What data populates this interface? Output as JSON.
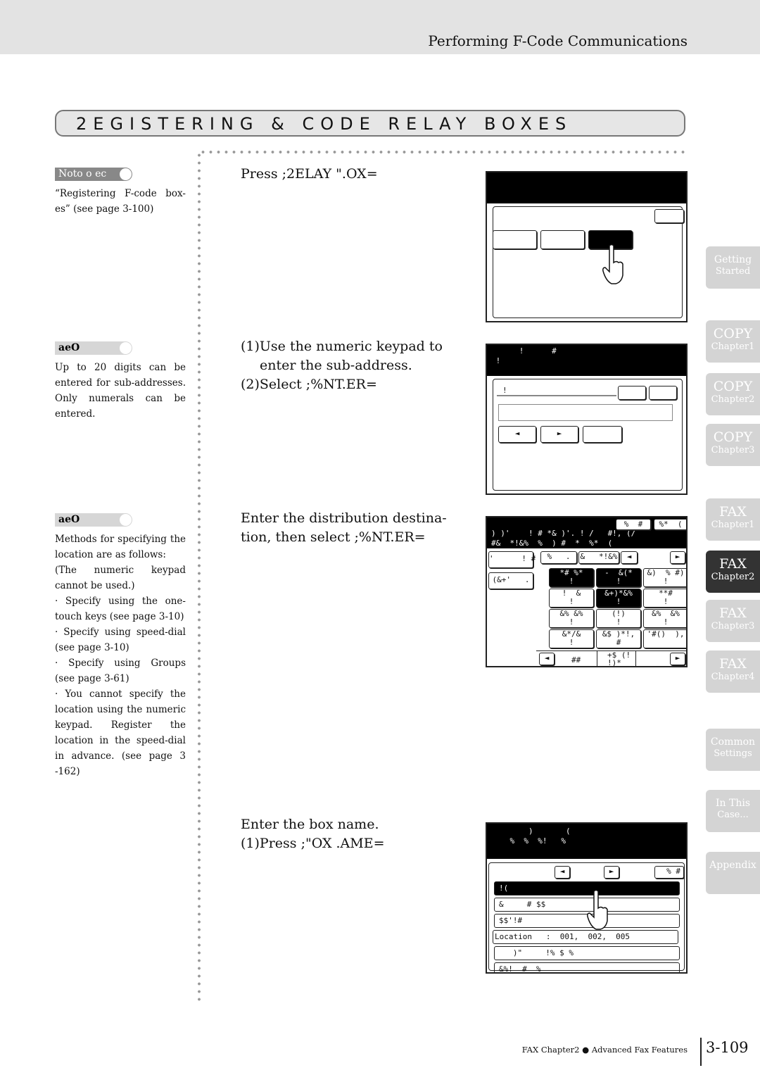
{
  "header": {
    "title": "Performing F-Code Communications"
  },
  "section_title": "2EGISTERING & CODE RELAY BOXES",
  "sidebar_notes": [
    {
      "label": "Noto o ec",
      "text": "“Registering F-code box-es” (see page 3-100)"
    },
    {
      "label": "aeO",
      "text": "Up to 20 digits can be entered for sub-addresses. Only numerals can be entered."
    },
    {
      "label": "aeO",
      "lines": [
        "Methods for specifying the location are as follows:",
        "(The numeric keypad cannot be used.)",
        "· Specify using the one-touch keys (see page 3-10)",
        "· Specify using speed-dial (see page 3-10)",
        "· Specify using Groups (see page 3-61)",
        "· You cannot specify the location using the numeric keypad. Register the location in the speed-dial in advance. (see page 3 -162)"
      ]
    }
  ],
  "steps": [
    {
      "text": "Press ;2ELAY \".OX="
    },
    {
      "lines": [
        "(1)Use the numeric keypad to",
        "enter the sub-address.",
        "(2)Select ;%NT.ER="
      ]
    },
    {
      "lines": [
        "Enter the distribution destina-",
        "tion, then select ;%NT.ER="
      ]
    },
    {
      "lines": [
        "Enter the box name.",
        "(1)Press ;\"OX .AME="
      ]
    }
  ],
  "screen2": {
    "bar": "      !      #\n !",
    "field_label": "!",
    "prev": "◄",
    "next": "►"
  },
  "screen3": {
    "top_buttons": [
      "%  #",
      "%*  ("
    ],
    "bar": ") )'    ! # *& )'. ! /   #!, (/\n#&  *!&%  %  ) #  *  %*  (",
    "left_buttons": [
      "'      ! #",
      "(&+'   ."
    ],
    "tabs": [
      "%   .",
      "&   *!&%"
    ],
    "prev": "◄",
    "next": "►",
    "grid": [
      [
        "*# %*\n!",
        "-  &(*\n!",
        "&)  % #)\n!"
      ],
      [
        "!  &\n!",
        "&+)*&%\n!",
        "**#\n!"
      ],
      [
        "&% &%\n!",
        "(!)\n!",
        "&%  &%\n!"
      ],
      [
        "&*/&\n!",
        "&$ )*!,\n#",
        "'#()  ),"
      ]
    ],
    "dark_cells": [
      [
        0,
        0
      ],
      [
        0,
        1
      ],
      [
        1,
        1
      ]
    ],
    "page_label": "##",
    "page_label2": "+$ (!\n!)*"
  },
  "screen4": {
    "bar": "        )       (\n    %  %  %!   %",
    "prev": "◄",
    "next": "►",
    "corner": "% #",
    "rows": [
      "!(",
      "&     # $$",
      "$$'!#",
      "Location   :  001,  002,  005",
      "   )\"     !% $ %",
      "&%!  #  %"
    ]
  },
  "tabs": [
    {
      "t1": "Getting",
      "t2": "Started",
      "small": true
    },
    {
      "t1": "COPY",
      "t2": "Chapter1"
    },
    {
      "t1": "COPY",
      "t2": "Chapter2"
    },
    {
      "t1": "COPY",
      "t2": "Chapter3"
    },
    {
      "t1": "FAX",
      "t2": "Chapter1"
    },
    {
      "t1": "FAX",
      "t2": "Chapter2",
      "active": true
    },
    {
      "t1": "FAX",
      "t2": "Chapter3"
    },
    {
      "t1": "FAX",
      "t2": "Chapter4"
    },
    {
      "t1": "Common",
      "t2": "Settings",
      "small": true
    },
    {
      "t1": "In This",
      "t2": "Case...",
      "small": true
    },
    {
      "t1": "Appendix",
      "t2": "",
      "small": true
    }
  ],
  "footer": {
    "chapter": "FAX Chapter2",
    "bullet": "●",
    "section": "Advanced Fax Features",
    "page": "3-109"
  }
}
